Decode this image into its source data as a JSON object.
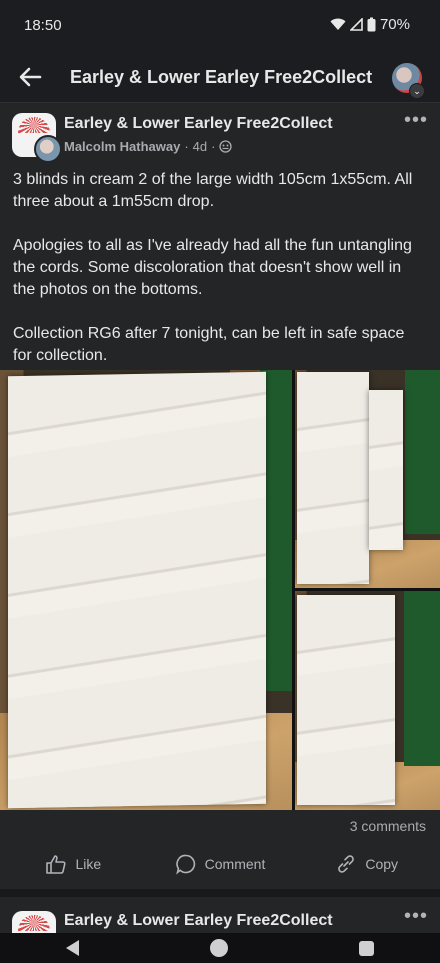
{
  "status": {
    "time": "18:50",
    "battery": "70%"
  },
  "appbar": {
    "title": "Earley & Lower Earley Free2Collect"
  },
  "post": {
    "group_name": "Earley & Lower Earley Free2Collect",
    "author": "Malcolm Hathaway",
    "age": "4d",
    "body": [
      "3 blinds in cream 2 of the large width 105cm 1x55cm. All three about a 1m55cm drop.",
      "Apologies to all as I've already had all the fun untangling the cords. Some discoloration that doesn't show well in the photos on the bottoms.",
      "Collection RG6 after 7 tonight, can be left in safe space for collection."
    ],
    "comments": "3 comments",
    "actions": {
      "like": "Like",
      "comment": "Comment",
      "copy": "Copy"
    }
  },
  "next_post": {
    "group_name": "Earley & Lower Earley Free2Collect"
  }
}
